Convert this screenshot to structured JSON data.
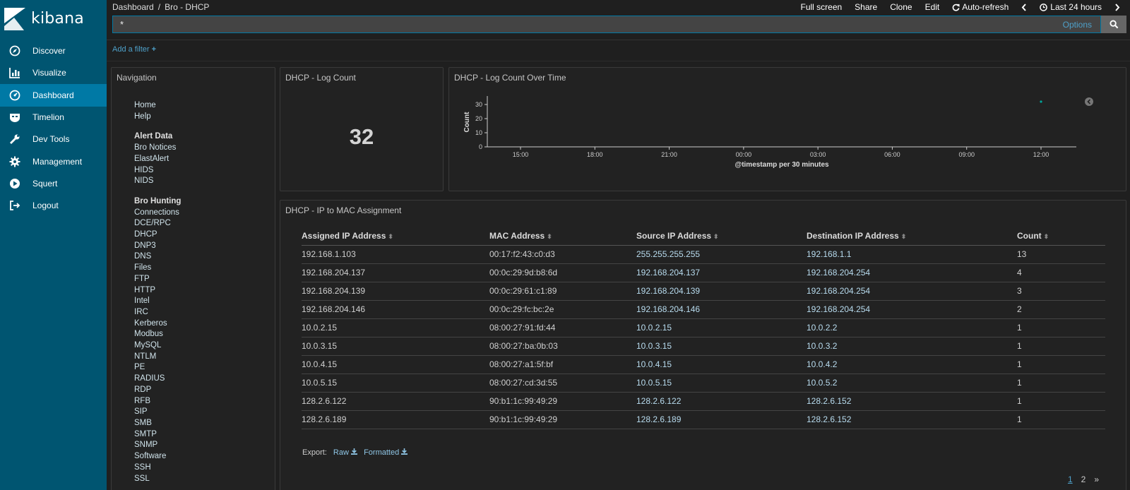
{
  "app": {
    "brand": "kibana"
  },
  "sidebar": {
    "items": [
      {
        "label": "Discover",
        "icon": "compass-icon",
        "active": false
      },
      {
        "label": "Visualize",
        "icon": "bar-chart-icon",
        "active": false
      },
      {
        "label": "Dashboard",
        "icon": "dashboard-gauge-icon",
        "active": true
      },
      {
        "label": "Timelion",
        "icon": "timelion-mask-icon",
        "active": false
      },
      {
        "label": "Dev Tools",
        "icon": "wrench-icon",
        "active": false
      },
      {
        "label": "Management",
        "icon": "gear-icon",
        "active": false
      },
      {
        "label": "Squert",
        "icon": "play-circle-icon",
        "active": false
      },
      {
        "label": "Logout",
        "icon": "logout-icon",
        "active": false
      }
    ]
  },
  "breadcrumb": {
    "root": "Dashboard",
    "separator": "/",
    "current": "Bro - DHCP"
  },
  "topmenu": {
    "full_screen": "Full screen",
    "share": "Share",
    "clone": "Clone",
    "edit": "Edit",
    "auto_refresh": "Auto-refresh",
    "time_range": "Last 24 hours"
  },
  "query": {
    "value": "*",
    "options_label": "Options"
  },
  "filter": {
    "add_label": "Add a filter"
  },
  "navigation_panel": {
    "title": "Navigation",
    "links_top": [
      "Home",
      "Help"
    ],
    "alert_header": "Alert Data",
    "alert_links": [
      "Bro Notices",
      "ElastAlert",
      "HIDS",
      "NIDS"
    ],
    "hunting_header": "Bro Hunting",
    "hunting_links": [
      "Connections",
      "DCE/RPC",
      "DHCP",
      "DNP3",
      "DNS",
      "Files",
      "FTP",
      "HTTP",
      "Intel",
      "IRC",
      "Kerberos",
      "Modbus",
      "MySQL",
      "NTLM",
      "PE",
      "RADIUS",
      "RDP",
      "RFB",
      "SIP",
      "SMB",
      "SMTP",
      "SNMP",
      "Software",
      "SSH",
      "SSL"
    ]
  },
  "count_panel": {
    "title": "DHCP - Log Count",
    "value": "32"
  },
  "time_panel": {
    "title": "DHCP - Log Count Over Time"
  },
  "chart_data": {
    "type": "scatter",
    "title": "DHCP - Log Count Over Time",
    "xlabel": "@timestamp per 30 minutes",
    "ylabel": "Count",
    "x_ticks": [
      "15:00",
      "18:00",
      "21:00",
      "00:00",
      "03:00",
      "06:00",
      "09:00",
      "12:00"
    ],
    "y_ticks": [
      "0",
      "10",
      "20",
      "30"
    ],
    "ylim": [
      0,
      35
    ],
    "points": [
      {
        "x": "12:00",
        "y": 32
      }
    ],
    "point_color": "#00a69b",
    "grid": false
  },
  "table_panel": {
    "title": "DHCP - IP to MAC Assignment",
    "columns": [
      "Assigned IP Address",
      "MAC Address",
      "Source IP Address",
      "Destination IP Address",
      "Count"
    ],
    "rows": [
      [
        "192.168.1.103",
        "00:17:f2:43:c0:d3",
        "255.255.255.255",
        "192.168.1.1",
        "13"
      ],
      [
        "192.168.204.137",
        "00:0c:29:9d:b8:6d",
        "192.168.204.137",
        "192.168.204.254",
        "4"
      ],
      [
        "192.168.204.139",
        "00:0c:29:61:c1:89",
        "192.168.204.139",
        "192.168.204.254",
        "3"
      ],
      [
        "192.168.204.146",
        "00:0c:29:fc:bc:2e",
        "192.168.204.146",
        "192.168.204.254",
        "2"
      ],
      [
        "10.0.2.15",
        "08:00:27:91:fd:44",
        "10.0.2.15",
        "10.0.2.2",
        "1"
      ],
      [
        "10.0.3.15",
        "08:00:27:ba:0b:03",
        "10.0.3.15",
        "10.0.3.2",
        "1"
      ],
      [
        "10.0.4.15",
        "08:00:27:a1:5f:bf",
        "10.0.4.15",
        "10.0.4.2",
        "1"
      ],
      [
        "10.0.5.15",
        "08:00:27:cd:3d:55",
        "10.0.5.15",
        "10.0.5.2",
        "1"
      ],
      [
        "128.2.6.122",
        "90:b1:1c:99:49:29",
        "128.2.6.122",
        "128.2.6.152",
        "1"
      ],
      [
        "128.2.6.189",
        "90:b1:1c:99:49:29",
        "128.2.6.189",
        "128.2.6.152",
        "1"
      ]
    ],
    "export_label": "Export:",
    "export_raw": "Raw",
    "export_formatted": "Formatted",
    "pages": [
      "1",
      "2",
      "»"
    ],
    "current_page": "1"
  },
  "colors": {
    "sidebar": "#005571",
    "active": "#0079a5",
    "link": "#4ea0c9"
  }
}
